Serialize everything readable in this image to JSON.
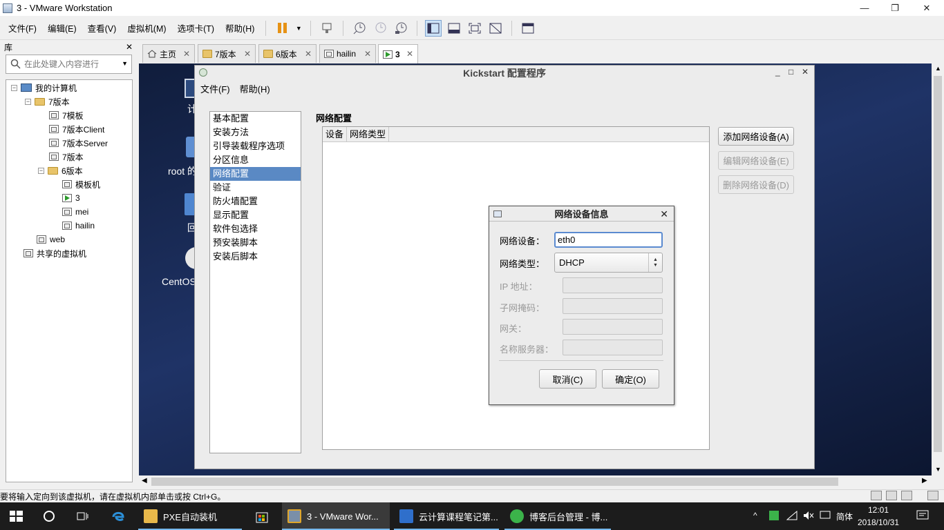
{
  "window": {
    "title": "3 - VMware Workstation",
    "minimize": "—",
    "maximize": "❐",
    "close": "✕"
  },
  "menu": [
    "文件(F)",
    "编辑(E)",
    "查看(V)",
    "虚拟机(M)",
    "选项卡(T)",
    "帮助(H)"
  ],
  "library": {
    "title": "库",
    "close": "✕",
    "search_placeholder": "在此处键入内容进行",
    "tree": [
      {
        "label": "我的计算机",
        "icon": "computer-icon",
        "level": 0,
        "expander": "−"
      },
      {
        "label": "7版本",
        "icon": "folder-icon",
        "level": 1,
        "expander": "−"
      },
      {
        "label": "7模板",
        "icon": "vm-icon",
        "level": 2
      },
      {
        "label": "7版本Client",
        "icon": "vm-icon",
        "level": 2
      },
      {
        "label": "7版本Server",
        "icon": "vm-icon",
        "level": 2
      },
      {
        "label": "7版本",
        "icon": "vm-icon",
        "level": 2
      },
      {
        "label": "6版本",
        "icon": "folder-icon",
        "level": 1,
        "expander": "−"
      },
      {
        "label": "模板机",
        "icon": "vm-icon",
        "level": 3
      },
      {
        "label": "3",
        "icon": "vm-running-icon",
        "level": 3
      },
      {
        "label": "mei",
        "icon": "vm-icon",
        "level": 3
      },
      {
        "label": "hailin",
        "icon": "vm-icon",
        "level": 3
      },
      {
        "label": "web",
        "icon": "vm-icon",
        "level": 1
      },
      {
        "label": "共享的虚拟机",
        "icon": "shared-vm-icon",
        "level": 0
      }
    ]
  },
  "tabs": [
    {
      "label": "主页",
      "icon": "home-icon",
      "close": "✕"
    },
    {
      "label": "7版本",
      "icon": "folder-icon",
      "close": "✕"
    },
    {
      "label": "6版本",
      "icon": "folder-icon",
      "close": "✕"
    },
    {
      "label": "hailin",
      "icon": "vm-icon",
      "close": "✕"
    },
    {
      "label": "3",
      "icon": "vm-running-icon",
      "close": "✕",
      "active": true
    }
  ],
  "desktop_icons": [
    "计",
    "root 的",
    "回",
    "CentOS"
  ],
  "kickstart": {
    "title": "Kickstart 配置程序",
    "minimize": "_",
    "maximize": "□",
    "close": "✕",
    "menu": [
      "文件(F)",
      "帮助(H)"
    ],
    "nav": [
      "基本配置",
      "安装方法",
      "引导装载程序选项",
      "分区信息",
      "网络配置",
      "验证",
      "防火墙配置",
      "显示配置",
      "软件包选择",
      "预安装脚本",
      "安装后脚本"
    ],
    "nav_selected": "网络配置",
    "section_title": "网络配置",
    "table_columns": [
      "设备",
      "网络类型"
    ],
    "buttons": {
      "add": "添加网络设备(A)",
      "edit": "编辑网络设备(E)",
      "delete": "删除网络设备(D)"
    }
  },
  "dialog": {
    "title": "网络设备信息",
    "close": "✕",
    "device_label": "网络设备：",
    "device_value": "eth0",
    "type_label": "网络类型：",
    "type_value": "DHCP",
    "spin_up": "▲",
    "spin_down": "▼",
    "ip_label": "IP 地址：",
    "netmask_label": "子网掩码：",
    "gateway_label": "网关：",
    "dns_label": "名称服务器：",
    "cancel": "取消(C)",
    "ok": "确定(O)"
  },
  "statusbar": {
    "text": "要将输入定向到该虚拟机，请在虚拟机内部单击或按 Ctrl+G。"
  },
  "taskbar": {
    "apps": [
      {
        "label": "PXE自动装机",
        "icon": "folder-icon",
        "color": "#e8b84a"
      },
      {
        "label": "3 - VMware Wor...",
        "icon": "vmware-icon",
        "color": "#7a8fa8",
        "active": true
      },
      {
        "label": "云计算课程笔记第...",
        "icon": "wps-icon",
        "color": "#2f6fcb"
      },
      {
        "label": "博客后台管理 - 博...",
        "icon": "browser-icon",
        "color": "#3bb34a"
      }
    ],
    "time": "12:01",
    "date": "2018/10/31",
    "ime": "简体",
    "tray_up": "^"
  },
  "colors": {
    "accent": "#5a89c4",
    "vm_background": "#1f3366",
    "taskbar": "#1c1c1c"
  }
}
